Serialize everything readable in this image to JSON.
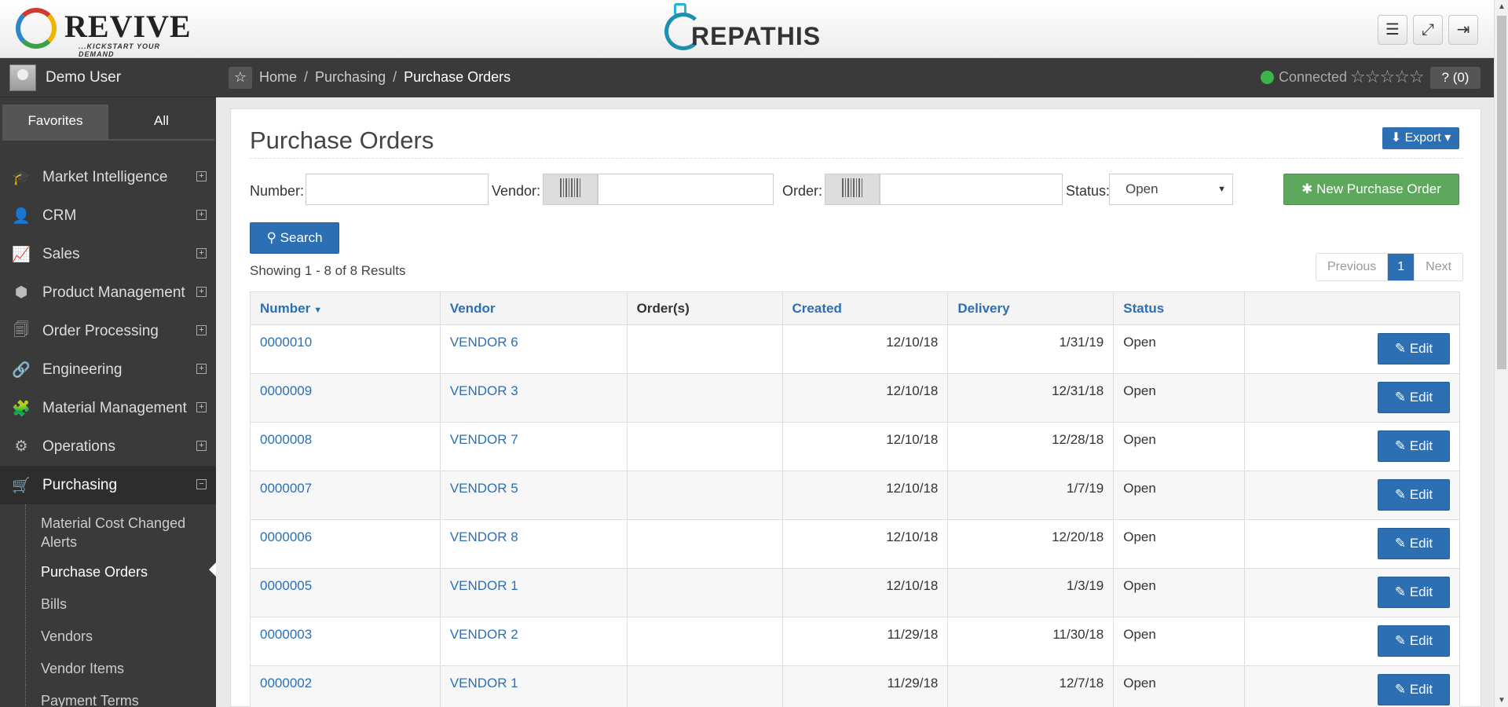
{
  "header": {
    "brand_left": "REVIVE",
    "brand_left_tagline": "...KICKSTART YOUR DEMAND",
    "brand_center": "REPATHIS",
    "buttons": [
      {
        "icon": "hamburger-icon",
        "glyph": "☰"
      },
      {
        "icon": "fullscreen-icon",
        "glyph": "⤢"
      },
      {
        "icon": "logout-icon",
        "glyph": "⇥"
      }
    ]
  },
  "sidebar": {
    "user": "Demo User",
    "tabs": [
      "Favorites",
      "All"
    ],
    "items": [
      {
        "label": "Market Intelligence",
        "icon": "graduation-cap-icon",
        "glyph": "🎓",
        "toggle": "+"
      },
      {
        "label": "CRM",
        "icon": "user-icon",
        "glyph": "👤",
        "toggle": "+"
      },
      {
        "label": "Sales",
        "icon": "line-chart-icon",
        "glyph": "📈",
        "toggle": "+"
      },
      {
        "label": "Product Management",
        "icon": "cube-icon",
        "glyph": "⬢",
        "toggle": "+"
      },
      {
        "label": "Order Processing",
        "icon": "documents-icon",
        "glyph": "🗐",
        "toggle": "+"
      },
      {
        "label": "Engineering",
        "icon": "link-icon",
        "glyph": "🔗",
        "toggle": "+"
      },
      {
        "label": "Material Management",
        "icon": "puzzle-icon",
        "glyph": "🧩",
        "toggle": "+"
      },
      {
        "label": "Operations",
        "icon": "gears-icon",
        "glyph": "⚙",
        "toggle": "+"
      },
      {
        "label": "Purchasing",
        "icon": "cart-icon",
        "glyph": "🛒",
        "toggle": "−"
      }
    ],
    "subitems": [
      "Material Cost Changed Alerts",
      "Purchase Orders",
      "Bills",
      "Vendors",
      "Vendor Items",
      "Payment Terms"
    ]
  },
  "breadcrumb": {
    "items": [
      "Home",
      "Purchasing",
      "Purchase Orders"
    ],
    "status": "Connected",
    "rating": "☆☆☆☆☆",
    "help": "? (0)"
  },
  "page": {
    "title": "Purchase Orders",
    "export_label": "Export",
    "filters": {
      "number_label": "Number:",
      "vendor_label": "Vendor:",
      "order_label": "Order:",
      "status_label": "Status:",
      "status_value": "Open",
      "number_value": "",
      "vendor_value": "",
      "order_value": ""
    },
    "new_button": "New Purchase Order",
    "search_button": "Search",
    "showing": "Showing 1 - 8 of 8 Results",
    "pager": {
      "previous": "Previous",
      "current": "1",
      "next": "Next"
    }
  },
  "table": {
    "columns": [
      "Number",
      "Vendor",
      "Order(s)",
      "Created",
      "Delivery",
      "Status"
    ],
    "edit_label": "Edit",
    "rows": [
      {
        "number": "0000010",
        "vendor": "VENDOR 6",
        "orders": "",
        "created": "12/10/18",
        "delivery": "1/31/19",
        "status": "Open"
      },
      {
        "number": "0000009",
        "vendor": "VENDOR 3",
        "orders": "",
        "created": "12/10/18",
        "delivery": "12/31/18",
        "status": "Open"
      },
      {
        "number": "0000008",
        "vendor": "VENDOR 7",
        "orders": "",
        "created": "12/10/18",
        "delivery": "12/28/18",
        "status": "Open"
      },
      {
        "number": "0000007",
        "vendor": "VENDOR 5",
        "orders": "",
        "created": "12/10/18",
        "delivery": "1/7/19",
        "status": "Open"
      },
      {
        "number": "0000006",
        "vendor": "VENDOR 8",
        "orders": "",
        "created": "12/10/18",
        "delivery": "12/20/18",
        "status": "Open"
      },
      {
        "number": "0000005",
        "vendor": "VENDOR 1",
        "orders": "",
        "created": "12/10/18",
        "delivery": "1/3/19",
        "status": "Open"
      },
      {
        "number": "0000003",
        "vendor": "VENDOR 2",
        "orders": "",
        "created": "11/29/18",
        "delivery": "11/30/18",
        "status": "Open"
      },
      {
        "number": "0000002",
        "vendor": "VENDOR 1",
        "orders": "",
        "created": "11/29/18",
        "delivery": "12/7/18",
        "status": "Open"
      }
    ]
  },
  "colors": {
    "primary": "#2d6fb3",
    "success": "#5ea85e",
    "sidebar": "#3a3a3a",
    "connected": "#3bb54a"
  }
}
